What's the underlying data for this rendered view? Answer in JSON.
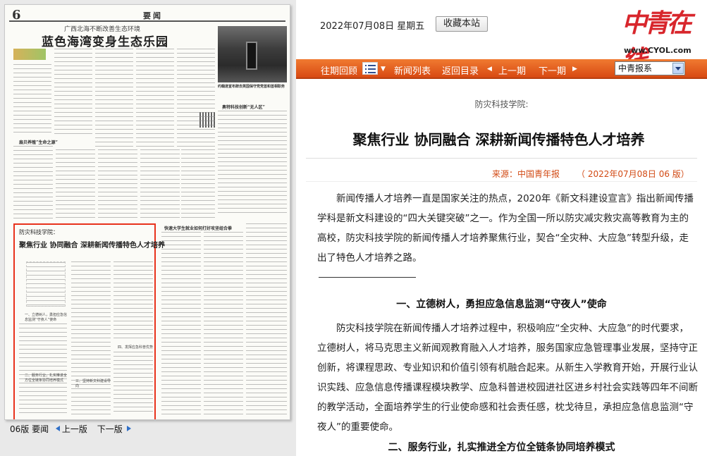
{
  "paper": {
    "page_number": "6",
    "section": "要闻",
    "kicker": "广西北海不断改善生态环境",
    "headline": "蓝色海湾变身生态乐园",
    "photo_caption": "约翰逊宣布辞去英国保守党党首和首相职务",
    "sub1": "奥特科技创新“无人区”",
    "sub2": "扇贝养殖”生命之源”",
    "sub3": "快速大学生就业如何打好攻坚组合拳",
    "highlight": {
      "kicker": "防灾科技学院：",
      "title": "聚焦行业 协同融合 深耕新闻传播特色人才培养",
      "h1": "一、立德树人，勇担应急信息监测“守夜人”使命",
      "h2": "二、服务行业，扎实推进全方位全链条协同培养模式",
      "h3": "三、坚持新文科建设导向",
      "h4": "四、发挥应急科普优势"
    },
    "nav": {
      "page_label": "06版 要闻",
      "prev": "上一版",
      "next": "下一版"
    }
  },
  "header": {
    "date": "2022年07月08日  星期五",
    "bookmark": "收藏本站",
    "logo_text": "中青在线",
    "logo_url": "www.CYOL.com"
  },
  "nav": {
    "history": "往期回顾",
    "list": "新闻列表",
    "back": "返回目录",
    "prev": "上一期",
    "next": "下一期",
    "select_value": "中青报系"
  },
  "article": {
    "kicker": "防灾科技学院:",
    "title": "聚焦行业 协同融合 深耕新闻传播特色人才培养",
    "source": "来源：中国青年报",
    "date": "（ 2022年07月08日    06 版）",
    "para1": "新闻传播人才培养一直是国家关注的热点，2020年《新文科建设宣言》指出新闻传播学科是新文科建设的“四大关键突破”之一。作为全国一所以防灾减灾救灾高等教育为主的高校，防灾科技学院的新闻传播人才培养聚焦行业，契合“全灾种、大应急”转型升级，走出了特色人才培养之路。",
    "heading1": "一、立德树人，勇担应急信息监测“守夜人”使命",
    "para2": "防灾科技学院在新闻传播人才培养过程中，积极响应“全灾种、大应急”的时代要求，立德树人，将马克思主义新闻观教育融入人才培养，服务国家应急管理事业发展，坚持守正创新，将课程思政、专业知识和价值引领有机融合起来。从新生入学教育开始，开展行业认识实践、应急信息传播课程模块教学、应急科普进校园进社区进乡村社会实践等四年不间断的教学活动，全面培养学生的行业使命感和社会责任感，枕戈待旦，承担应急信息监测“守夜人”的重要使命。",
    "heading2": "二、服务行业，扎实推进全方位全链条协同培养模式"
  }
}
